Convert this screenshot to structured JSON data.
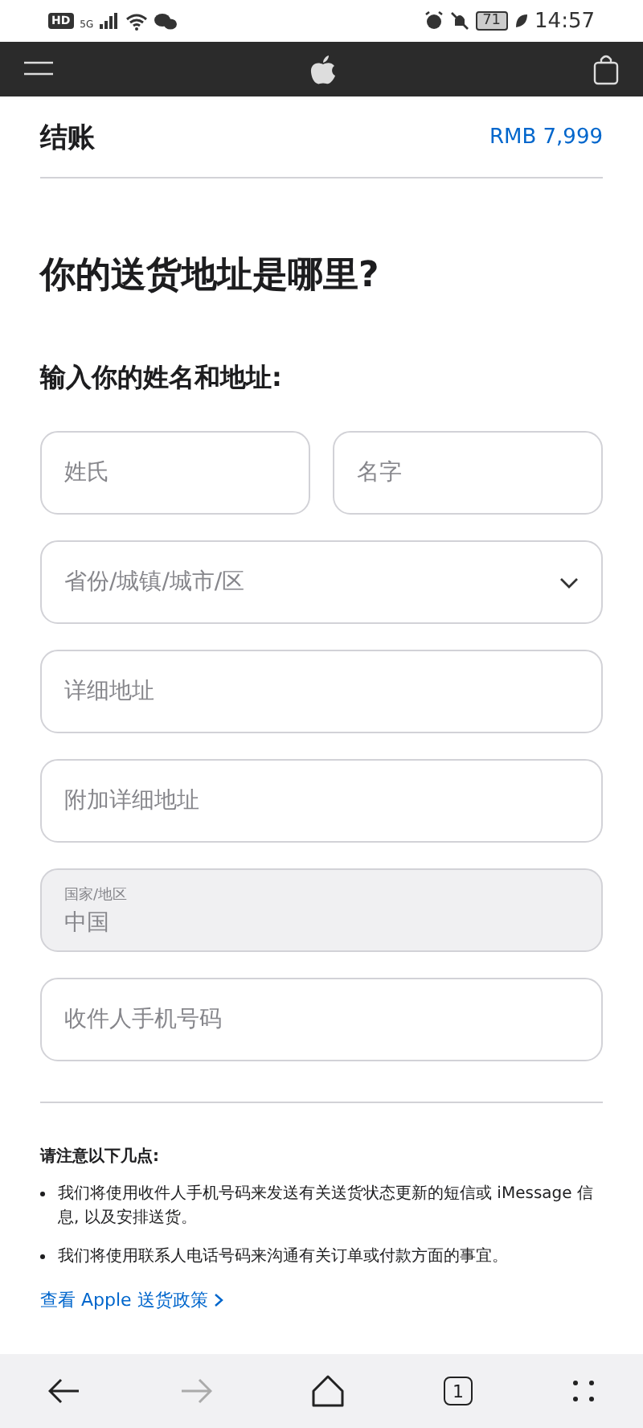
{
  "status_bar": {
    "hd": "HD",
    "network": "5G",
    "battery": "71",
    "time": "14:57"
  },
  "header": {
    "title": "结账",
    "total": "RMB 7,999"
  },
  "heading": "你的送货地址是哪里?",
  "subheading": "输入你的姓名和地址:",
  "fields": [
    {
      "kind": "pair",
      "items": [
        {
          "placeholder": "姓氏"
        },
        {
          "placeholder": "名字"
        }
      ]
    },
    {
      "kind": "select",
      "placeholder": "省份/城镇/城市/区"
    },
    {
      "kind": "input",
      "placeholder": "详细地址"
    },
    {
      "kind": "input",
      "placeholder": "附加详细地址"
    },
    {
      "kind": "labeled",
      "label": "国家/地区",
      "value": "中国",
      "disabled": true
    },
    {
      "kind": "input",
      "placeholder": "收件人手机号码"
    }
  ],
  "notes": {
    "title": "请注意以下几点:",
    "items": [
      "我们将使用收件人手机号码来发送有关送货状态更新的短信或 iMessage 信息, 以及安排送货。",
      "我们将使用联系人电话号码来沟通有关订单或付款方面的事宜。"
    ],
    "link": "查看 Apple 送货政策"
  },
  "browser_bar": {
    "back_disabled": false,
    "forward_disabled": true,
    "tab_count": "1"
  }
}
